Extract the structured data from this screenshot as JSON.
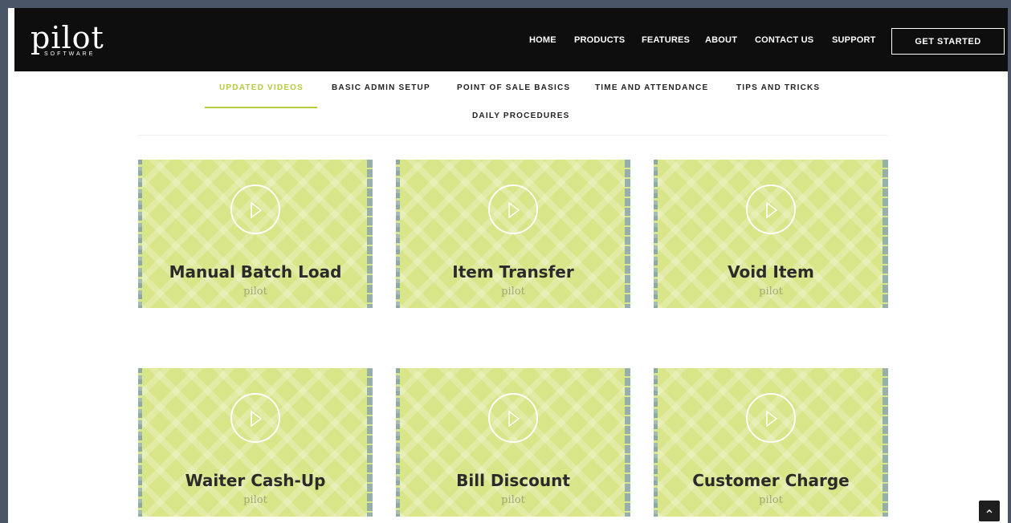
{
  "brand": {
    "logo_text": "pilot",
    "logo_sub": "SOFTWARE"
  },
  "nav": {
    "items": [
      "HOME",
      "PRODUCTS",
      "FEATURES",
      "ABOUT",
      "CONTACT US",
      "SUPPORT"
    ],
    "cta": "GET STARTED"
  },
  "tabs": {
    "items": [
      "UPDATED VIDEOS",
      "BASIC ADMIN SETUP",
      "POINT OF SALE BASICS",
      "TIME AND ATTENDANCE",
      "TIPS AND TRICKS",
      "DAILY PROCEDURES"
    ],
    "active": "UPDATED VIDEOS"
  },
  "videos": [
    {
      "title": "Manual Batch Load",
      "brand": "pilot"
    },
    {
      "title": "Item Transfer",
      "brand": "pilot"
    },
    {
      "title": "Void Item",
      "brand": "pilot"
    },
    {
      "title": "Waiter Cash-Up",
      "brand": "pilot"
    },
    {
      "title": "Bill Discount",
      "brand": "pilot"
    },
    {
      "title": "Customer Charge",
      "brand": "pilot"
    }
  ],
  "colors": {
    "accent": "#b5cc3f",
    "card_bg": "#d9e589",
    "header_bg": "#0e0e0e"
  },
  "icons": {
    "play": "play-icon",
    "scroll_top": "chevron-up-icon"
  }
}
